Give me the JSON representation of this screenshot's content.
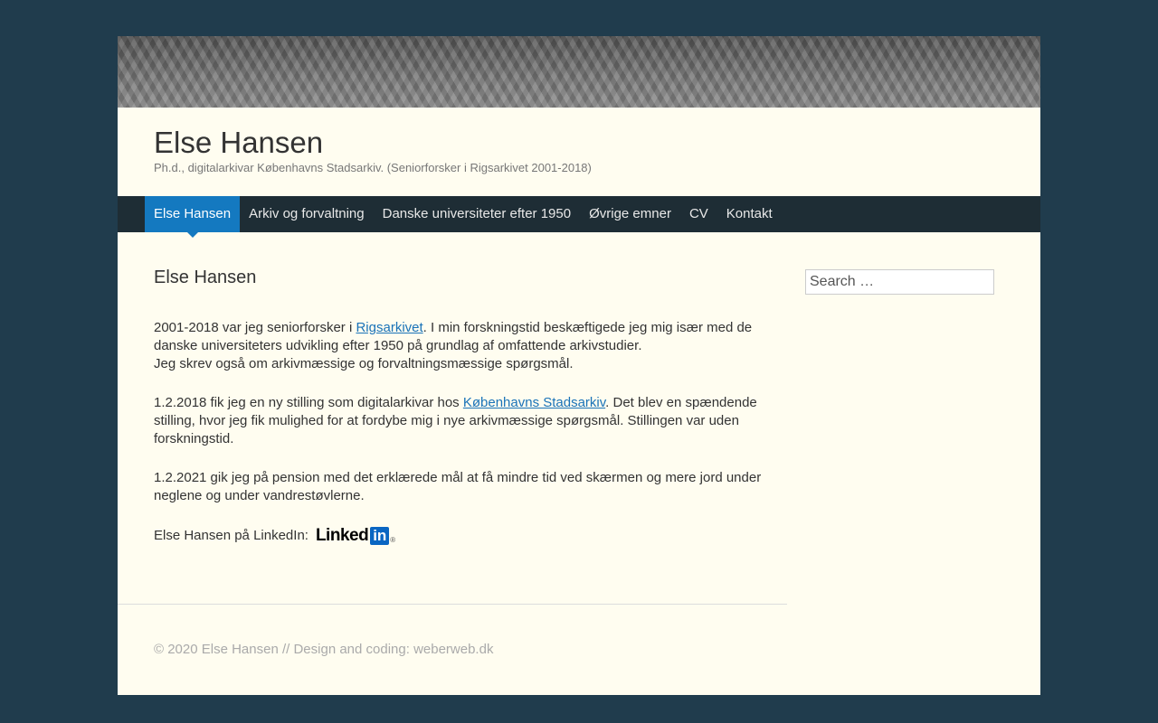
{
  "site": {
    "title": "Else Hansen",
    "description": "Ph.d., digitalarkivar Københavns Stadsarkiv. (Seniorforsker i Rigsarkivet 2001-2018)"
  },
  "nav": {
    "items": [
      {
        "label": "Else Hansen",
        "active": true
      },
      {
        "label": "Arkiv og forvaltning"
      },
      {
        "label": "Danske universiteter efter 1950"
      },
      {
        "label": "Øvrige emner"
      },
      {
        "label": "CV"
      },
      {
        "label": "Kontakt"
      }
    ]
  },
  "article": {
    "title": "Else Hansen",
    "p1": {
      "before": "2001-2018 var jeg seniorforsker i ",
      "link": "Rigsarkivet",
      "after": ". I min forskningstid beskæftigede jeg mig især med de danske universiteters udvikling efter 1950 på grundlag af omfattende arkivstudier.",
      "line2": "Jeg skrev også om arkivmæssige og forvaltningsmæssige spørgsmål."
    },
    "p2": {
      "before": "1.2.2018 fik jeg en ny stilling som digitalarkivar hos ",
      "link": "Københavns Stadsarkiv",
      "after": ". Det blev en spændende stilling, hvor jeg fik mulighed for at fordybe mig i nye arkivmæssige spørgsmål. Stillingen var uden forskningstid."
    },
    "p3": "1.2.2021 gik jeg på pension med det erklærede mål at få mindre tid ved skærmen og mere jord under neglene og under vandrestøvlerne.",
    "linkedin": {
      "label": "Else Hansen på LinkedIn:",
      "logo_word": "Linked",
      "logo_box": "in",
      "logo_reg": "®"
    }
  },
  "search": {
    "placeholder": "Search …"
  },
  "footer": {
    "text": "© 2020 Else Hansen // Design and coding: weberweb.dk"
  },
  "colors": {
    "background": "#203c4d",
    "page": "#fffdf0",
    "nav_bg": "#1e2d35",
    "nav_active": "#1479c0",
    "link": "#1a73b8"
  }
}
